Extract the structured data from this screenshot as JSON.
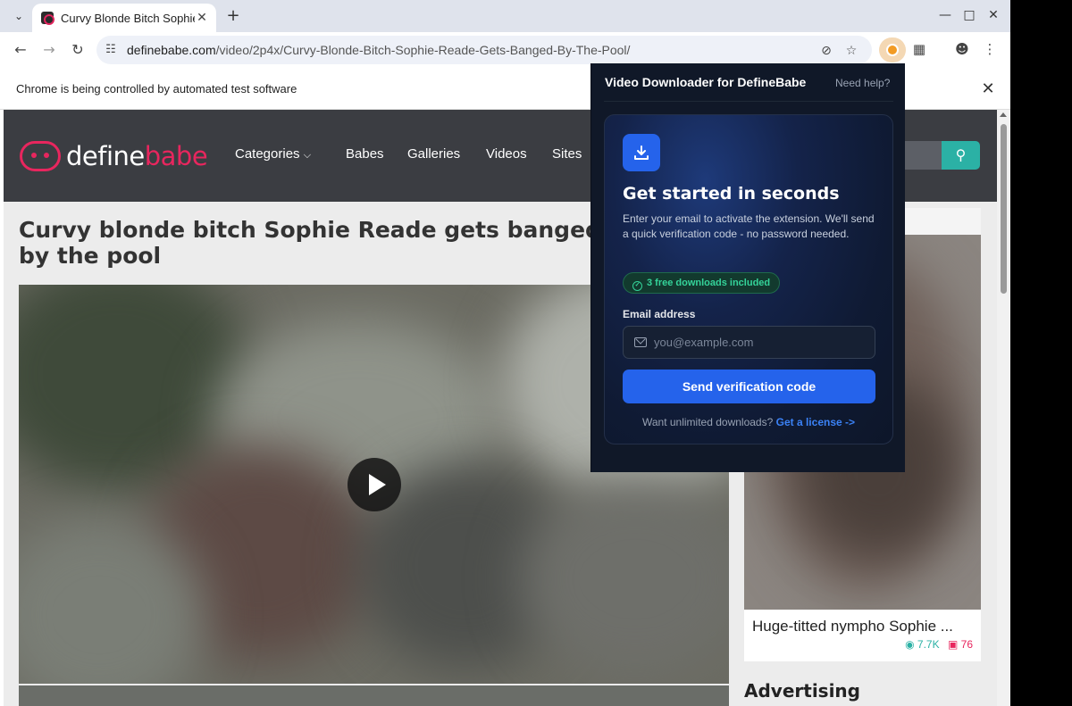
{
  "browser": {
    "tab_title": "Curvy Blonde Bitch Sophie Reade Gets Banged By The Pool",
    "url_domain": "definebabe.com",
    "url_path": "/video/2p4x/Curvy-Blonde-Bitch-Sophie-Reade-Gets-Banged-By-The-Pool/",
    "infobar_text": "Chrome is being controlled by automated test software"
  },
  "site": {
    "logo_part1": "define",
    "logo_part2": "babe",
    "nav": [
      "Categories",
      "Babes",
      "Galleries",
      "Videos",
      "Sites"
    ],
    "page_title": "Curvy blonde bitch Sophie Reade gets banged by the pool",
    "sidebar": {
      "card_title": "Huge-titted nympho Sophie ...",
      "views": "7.7K",
      "photos": "76",
      "advertising": "Advertising"
    }
  },
  "popup": {
    "title": "Video Downloader for DefineBabe",
    "help": "Need help?",
    "heading": "Get started in seconds",
    "description": "Enter your email to activate the extension. We'll send a quick verification code - no password needed.",
    "badge": "3 free downloads included",
    "email_label": "Email address",
    "email_placeholder": "you@example.com",
    "send_button": "Send verification code",
    "license_prompt": "Want unlimited downloads?",
    "license_link": "Get a license ->"
  },
  "colors": {
    "brand_pink": "#e8265e",
    "brand_teal": "#2bb1a5",
    "popup_bg": "#101828",
    "primary_blue": "#2563eb"
  }
}
